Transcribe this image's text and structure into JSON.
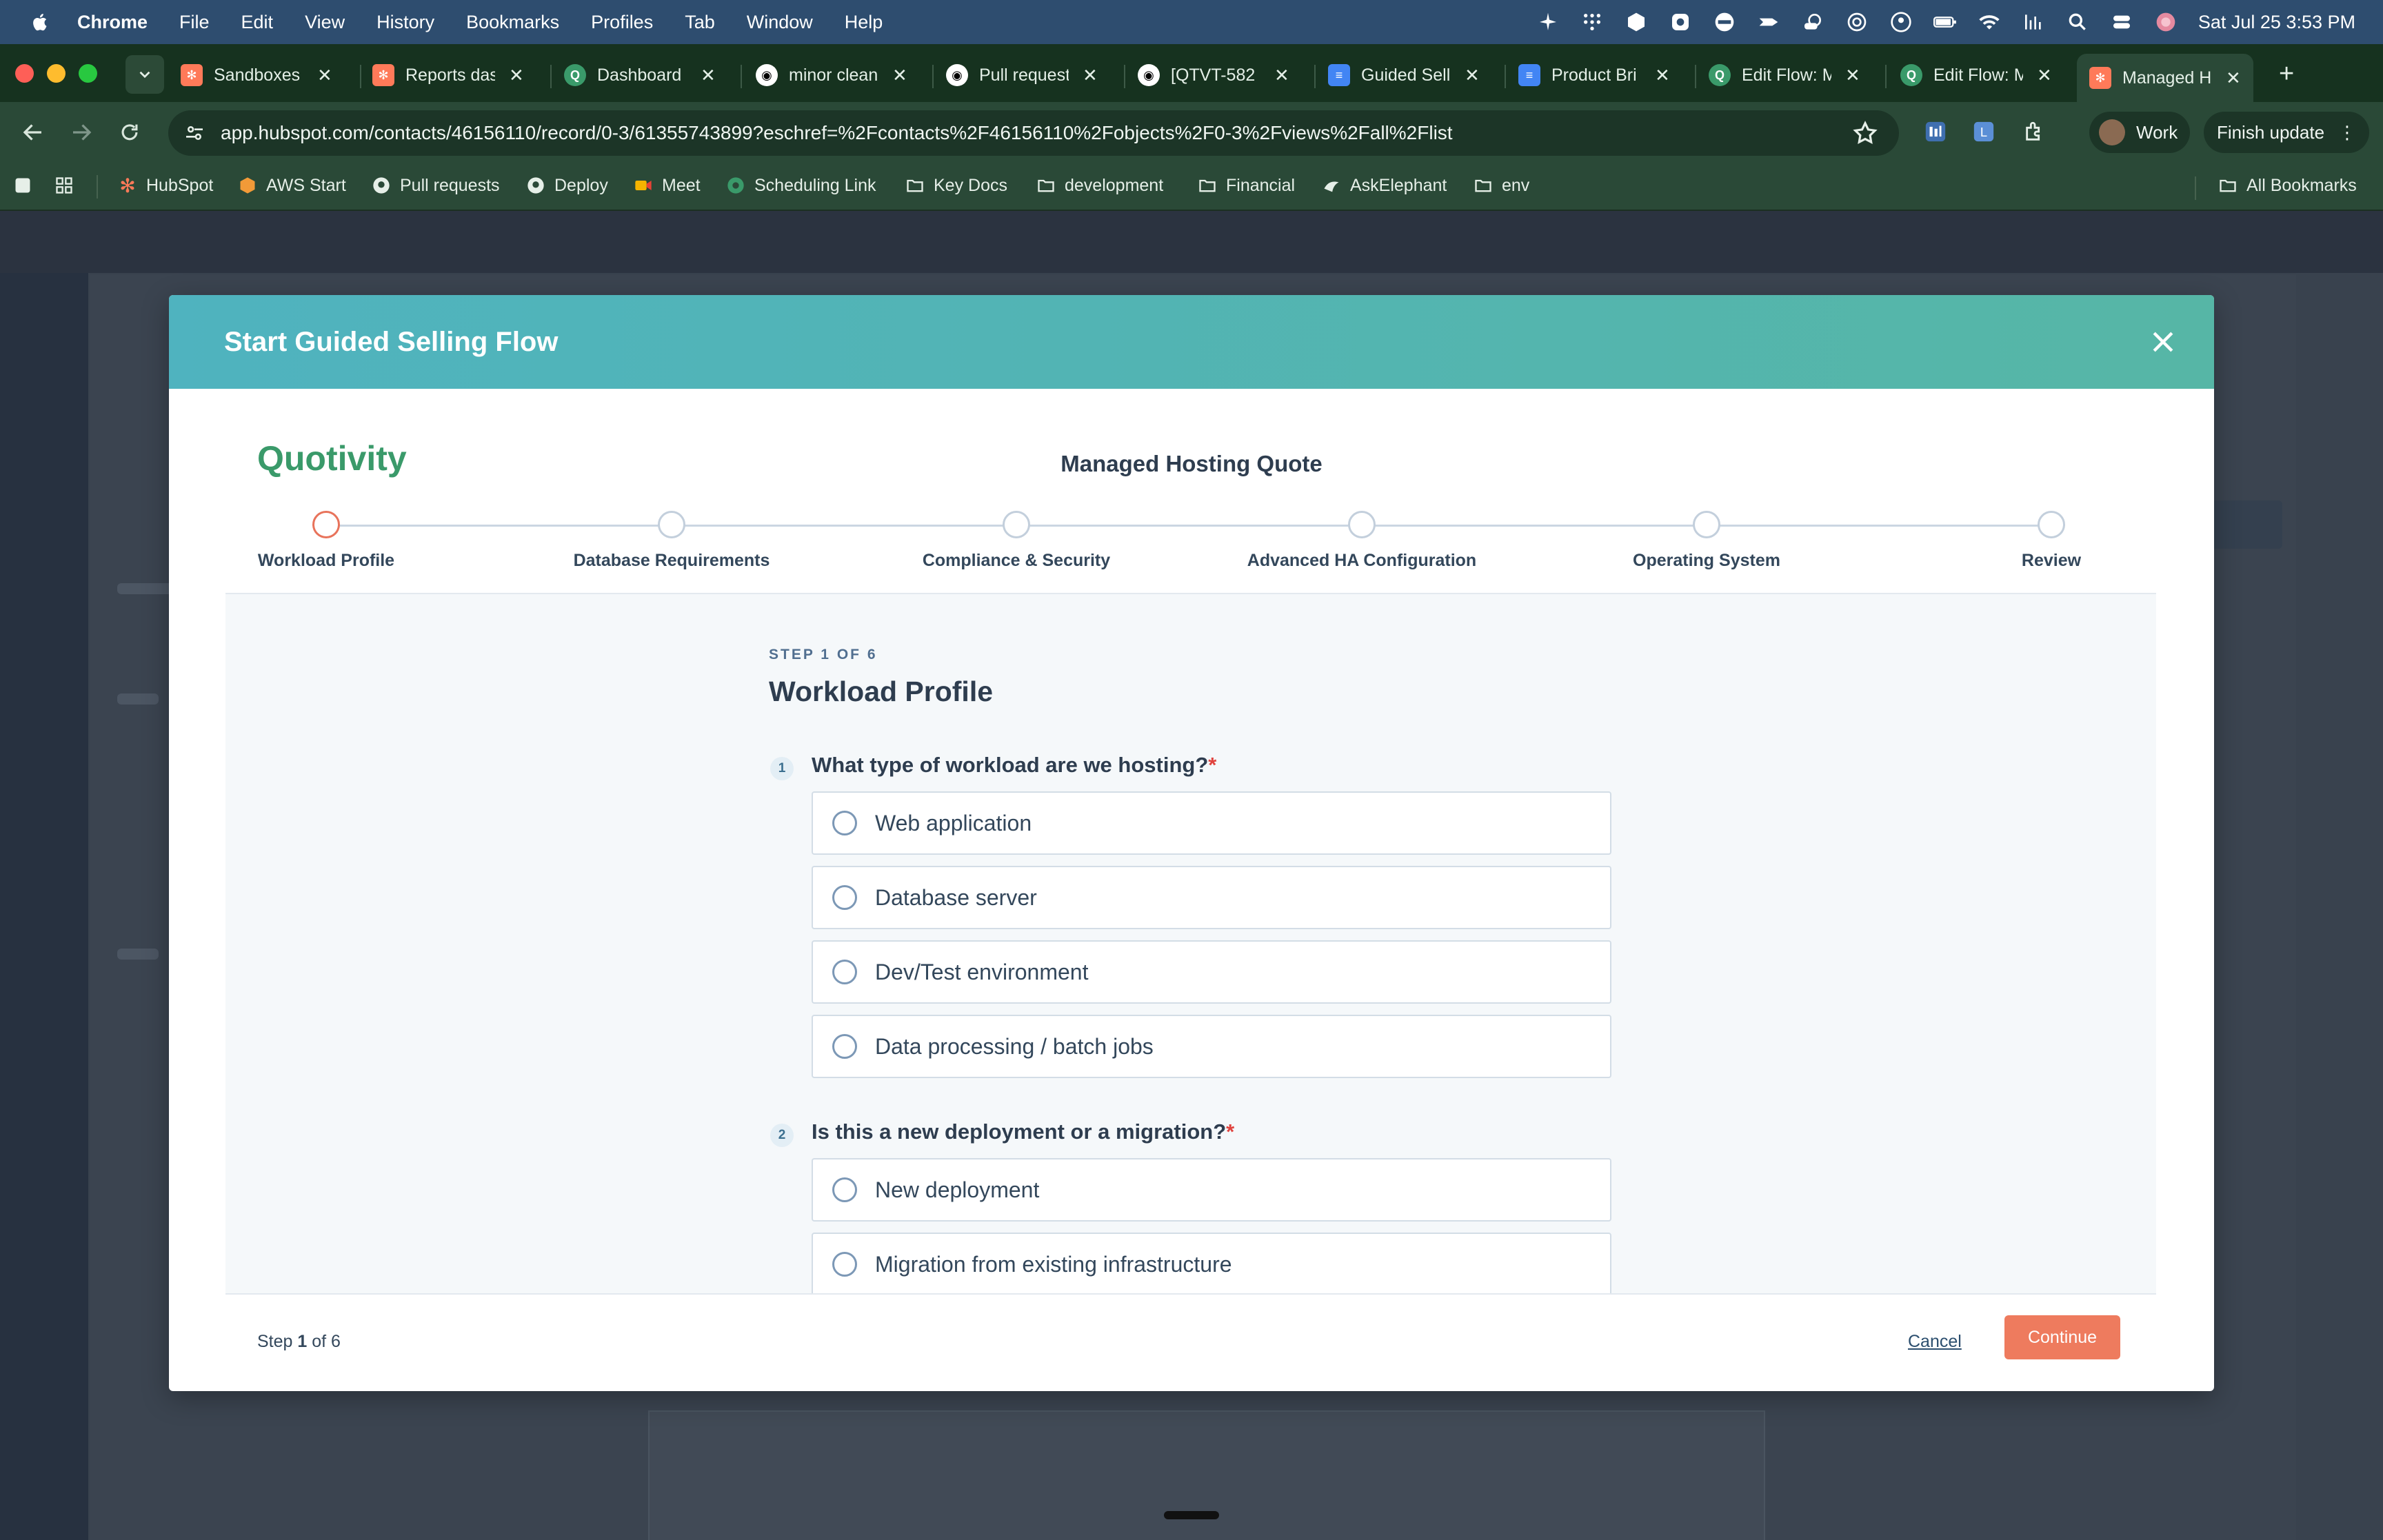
{
  "menubar": {
    "app": "Chrome",
    "items": [
      "File",
      "Edit",
      "View",
      "History",
      "Bookmarks",
      "Profiles",
      "Tab",
      "Window",
      "Help"
    ],
    "clock": "Sat Jul 25  3:53 PM"
  },
  "tabs": [
    {
      "title": "Sandboxes",
      "icon": "hubspot-icon"
    },
    {
      "title": "Reports das",
      "icon": "hubspot-icon"
    },
    {
      "title": "Dashboard",
      "icon": "quotivity-icon"
    },
    {
      "title": "minor clean",
      "icon": "github-icon"
    },
    {
      "title": "Pull request",
      "icon": "github-icon"
    },
    {
      "title": "[QTVT-582",
      "icon": "github-icon"
    },
    {
      "title": "Guided Selli",
      "icon": "docs-icon"
    },
    {
      "title": "Product Bri",
      "icon": "docs-icon"
    },
    {
      "title": "Edit Flow: M",
      "icon": "quotivity-icon"
    },
    {
      "title": "Edit Flow: M",
      "icon": "quotivity-icon"
    },
    {
      "title": "Managed H",
      "icon": "hubspot-icon",
      "active": true
    }
  ],
  "toolbar": {
    "url": "app.hubspot.com/contacts/46156110/record/0-3/61355743899?eschref=%2Fcontacts%2F46156110%2Fobjects%2F0-3%2Fviews%2Fall%2Flist",
    "profile": "Work",
    "update": "Finish update"
  },
  "bookmarks": [
    "HubSpot",
    "AWS Start",
    "Pull requests",
    "Deploy",
    "Meet",
    "Scheduling Link",
    "Key Docs",
    "development",
    "Financial",
    "AskElephant",
    "env"
  ],
  "all_bookmarks": "All Bookmarks",
  "modal": {
    "title": "Start Guided Selling Flow",
    "brand": "Quotivity",
    "flow_name": "Managed Hosting Quote",
    "steps": [
      "Workload Profile",
      "Database Requirements",
      "Compliance & Security",
      "Advanced HA Configuration",
      "Operating System",
      "Review"
    ],
    "active_step": 0,
    "kicker": "STEP 1 OF 6",
    "heading": "Workload Profile",
    "questions": [
      {
        "num": "1",
        "text": "What type of workload are we hosting?",
        "required_mark": "*",
        "options": [
          "Web application",
          "Database server",
          "Dev/Test environment",
          "Data processing / batch jobs"
        ]
      },
      {
        "num": "2",
        "text": "Is this a new deployment or a migration?",
        "required_mark": "*",
        "options": [
          "New deployment",
          "Migration from existing infrastructure"
        ]
      }
    ],
    "footer": {
      "step_prefix": "Step",
      "step_current": "1",
      "step_suffix": "of 6",
      "cancel": "Cancel",
      "continue": "Continue"
    }
  },
  "colors": {
    "header_gradient_start": "#4fb3bf",
    "header_gradient_end": "#56b6a6",
    "accent": "#ee7b5e",
    "brand_green": "#3a9a6a"
  }
}
